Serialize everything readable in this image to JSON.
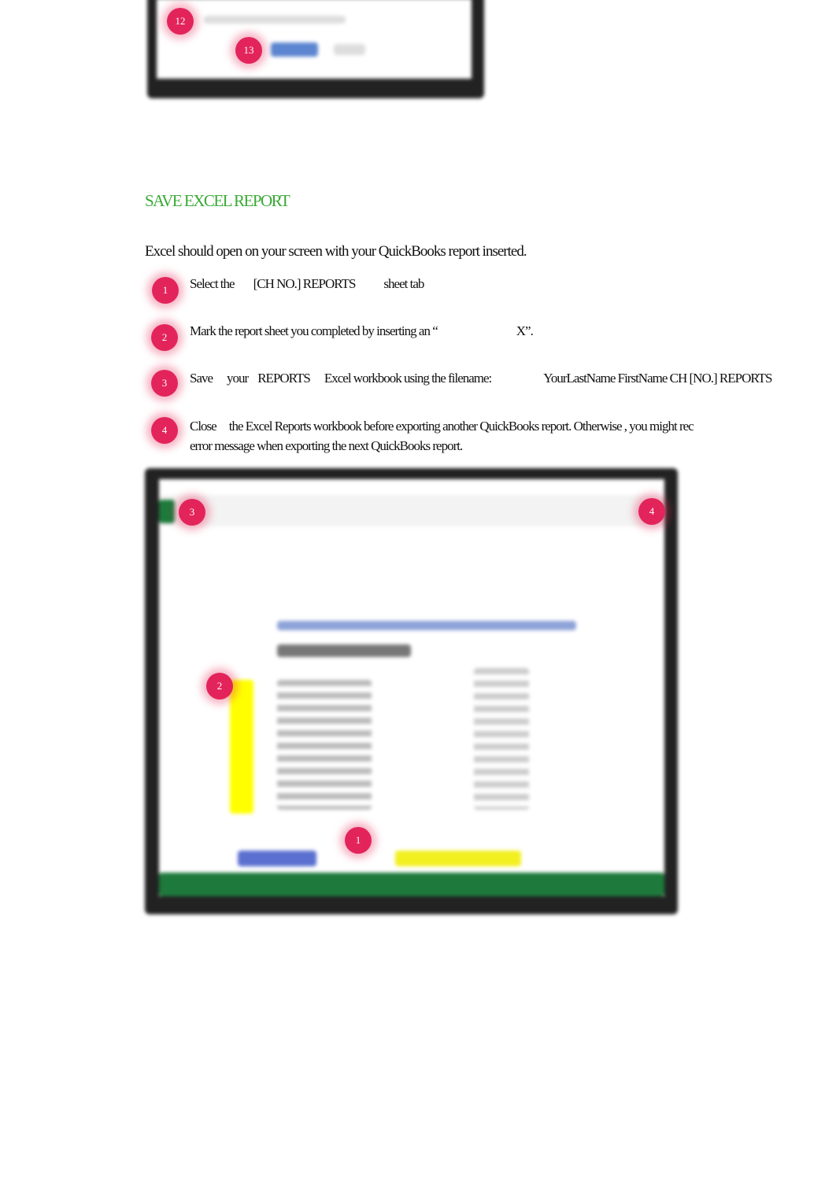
{
  "top_screenshot": {
    "badges": [
      "12",
      "13"
    ]
  },
  "section": {
    "title": "SAVE EXCEL REPORT",
    "intro": "Excel should open on your screen with your QuickBooks report inserted."
  },
  "steps": [
    {
      "num": "1",
      "parts": [
        "Select the",
        "[CH NO.] REPORTS",
        "sheet tab"
      ]
    },
    {
      "num": "2",
      "parts": [
        "Mark the report sheet you completed by inserting an “",
        "X”."
      ]
    },
    {
      "num": "3",
      "parts": [
        "Save",
        "your",
        "REPORTS",
        "Excel workbook using the filename:",
        "YourLastName FirstName CH [NO.] REPORTS"
      ]
    },
    {
      "num": "4",
      "parts": [
        "Close",
        "the Excel Reports workbook before exporting another QuickBooks report. Otherwise , you might rec",
        "error message when exporting the next QuickBooks report."
      ]
    }
  ],
  "excel_screenshot": {
    "badges": [
      "3",
      "4",
      "2",
      "1"
    ]
  },
  "colors": {
    "heading": "#3aaa35",
    "badge": "#e3245a",
    "excel_green": "#1e7a3c",
    "highlight": "#ffff00"
  }
}
